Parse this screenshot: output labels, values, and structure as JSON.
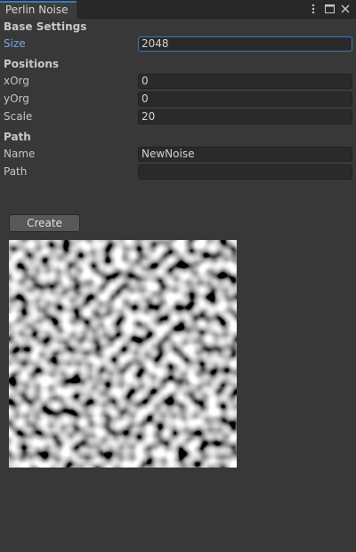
{
  "window": {
    "tab_title": "Perlin Noise"
  },
  "icons": {
    "menu": "kebab-menu-icon",
    "maximize": "maximize-icon",
    "close": "close-icon"
  },
  "base_settings": {
    "header": "Base Settings",
    "size_label": "Size",
    "size_value": "2048"
  },
  "positions": {
    "header": "Positions",
    "xorg_label": "xOrg",
    "xorg_value": "0",
    "yorg_label": "yOrg",
    "yorg_value": "0",
    "scale_label": "Scale",
    "scale_value": "20"
  },
  "path": {
    "header": "Path",
    "name_label": "Name",
    "name_value": "NewNoise",
    "path_label": "Path",
    "path_value": ""
  },
  "actions": {
    "create_label": "Create"
  },
  "colors": {
    "accent": "#3a79bb",
    "active_label": "#7aa7e3",
    "panel_bg": "#383838"
  }
}
